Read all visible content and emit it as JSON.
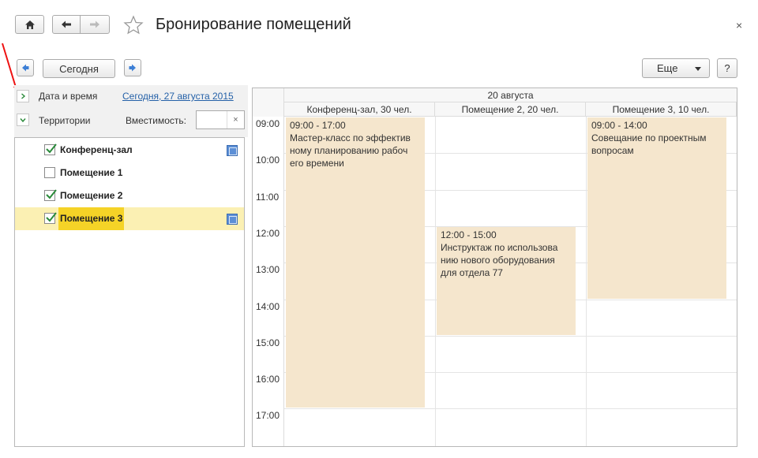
{
  "window": {
    "title": "Бронирование помещений",
    "close_glyph": "×"
  },
  "toolbar": {
    "today_label": "Сегодня",
    "more_label": "Еще",
    "help_label": "?"
  },
  "filters": {
    "datetime_label": "Дата и время",
    "datetime_value": "Сегодня, 27 августа 2015",
    "territories_label": "Территории",
    "capacity_label": "Вместимость:",
    "capacity_value": "",
    "clear_glyph": "×"
  },
  "rooms": [
    {
      "name": "Конференц-зал",
      "checked": true,
      "selected": false,
      "has_color": true
    },
    {
      "name": "Помещение 1",
      "checked": false,
      "selected": false,
      "has_color": false
    },
    {
      "name": "Помещение 2",
      "checked": true,
      "selected": false,
      "has_color": false
    },
    {
      "name": "Помещение 3",
      "checked": true,
      "selected": true,
      "has_color": true
    }
  ],
  "planner": {
    "date": "20 августа",
    "columns": [
      "Конференц-зал, 30 чел.",
      "Помещение 2, 20 чел.",
      "Помещение 3, 10 чел."
    ],
    "hours": [
      "09:00",
      "10:00",
      "11:00",
      "12:00",
      "13:00",
      "14:00",
      "15:00",
      "16:00",
      "17:00"
    ],
    "events": [
      {
        "column": 0,
        "start": 9,
        "end": 17,
        "time": "09:00 - 17:00",
        "text": "Мастер-класс по эффектив ному планированию рабоч его времени"
      },
      {
        "column": 1,
        "start": 12,
        "end": 15,
        "time": "12:00 - 15:00",
        "text": "Инструктаж по использова нию нового оборудования для отдела 77"
      },
      {
        "column": 2,
        "start": 9,
        "end": 14,
        "time": "09:00 - 14:00",
        "text": "Совещание по проектным вопросам"
      }
    ]
  },
  "colors": {
    "event_bg": "#f5e6cd",
    "selected_row": "#fbf0b3",
    "selected_name": "#f5d327",
    "link": "#2561a8",
    "check": "#2a8a3a"
  },
  "icons": {
    "home": "home-icon",
    "back": "arrow-left-icon",
    "forward": "arrow-right-icon",
    "favorite": "star-icon",
    "prev": "triangle-left-icon",
    "next": "triangle-right-icon",
    "dropdown": "caret-down-icon"
  }
}
